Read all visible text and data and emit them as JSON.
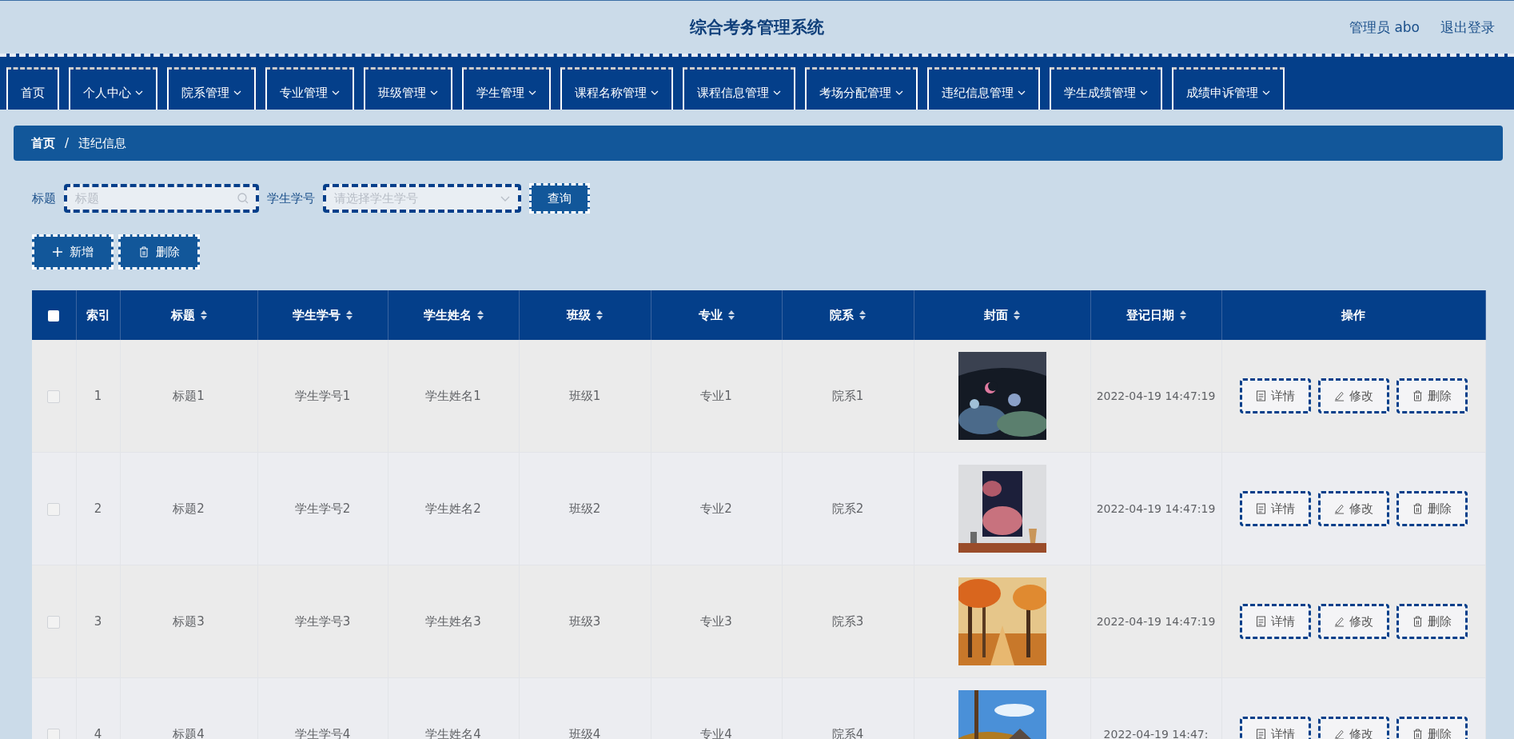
{
  "header": {
    "title": "综合考务管理系统",
    "user": "管理员 abo",
    "logout": "退出登录"
  },
  "nav": [
    {
      "label": "首页",
      "dropdown": false
    },
    {
      "label": "个人中心",
      "dropdown": true
    },
    {
      "label": "院系管理",
      "dropdown": true
    },
    {
      "label": "专业管理",
      "dropdown": true
    },
    {
      "label": "班级管理",
      "dropdown": true
    },
    {
      "label": "学生管理",
      "dropdown": true
    },
    {
      "label": "课程名称管理",
      "dropdown": true
    },
    {
      "label": "课程信息管理",
      "dropdown": true
    },
    {
      "label": "考场分配管理",
      "dropdown": true
    },
    {
      "label": "违纪信息管理",
      "dropdown": true
    },
    {
      "label": "学生成绩管理",
      "dropdown": true
    },
    {
      "label": "成绩申诉管理",
      "dropdown": true
    }
  ],
  "breadcrumb": [
    "首页",
    "/",
    "违纪信息"
  ],
  "search": {
    "title_label": "标题",
    "title_placeholder": "标题",
    "student_label": "学生学号",
    "student_placeholder": "请选择学生学号",
    "query_button": "查询"
  },
  "actions": {
    "add": "新增",
    "delete": "删除"
  },
  "table": {
    "columns": [
      {
        "label": "索引",
        "sortable": false
      },
      {
        "label": "标题",
        "sortable": true
      },
      {
        "label": "学生学号",
        "sortable": true
      },
      {
        "label": "学生姓名",
        "sortable": true
      },
      {
        "label": "班级",
        "sortable": true
      },
      {
        "label": "专业",
        "sortable": true
      },
      {
        "label": "院系",
        "sortable": true
      },
      {
        "label": "封面",
        "sortable": true
      },
      {
        "label": "登记日期",
        "sortable": true
      },
      {
        "label": "操作",
        "sortable": false
      }
    ],
    "rows": [
      {
        "checked": false,
        "index": "1",
        "title": "标题1",
        "student_no": "学生学号1",
        "student_name": "学生姓名1",
        "class": "班级1",
        "major": "专业1",
        "department": "院系1",
        "date": "2022-04-19 14:47:19"
      },
      {
        "checked": false,
        "index": "2",
        "title": "标题2",
        "student_no": "学生学号2",
        "student_name": "学生姓名2",
        "class": "班级2",
        "major": "专业2",
        "department": "院系2",
        "date": "2022-04-19 14:47:19"
      },
      {
        "checked": false,
        "index": "3",
        "title": "标题3",
        "student_no": "学生学号3",
        "student_name": "学生姓名3",
        "class": "班级3",
        "major": "专业3",
        "department": "院系3",
        "date": "2022-04-19 14:47:19"
      },
      {
        "checked": false,
        "index": "4",
        "title": "标题4",
        "student_no": "学生学号4",
        "student_name": "学生姓名4",
        "class": "班级4",
        "major": "专业4",
        "department": "院系4",
        "date": "2022-04-19 14:47:"
      }
    ],
    "row_actions": [
      [
        "详情",
        "修改",
        "删除"
      ],
      [
        "详情",
        "修改",
        "删除"
      ],
      [
        "详情",
        "修改",
        "删除"
      ],
      [
        "详情",
        "修改",
        "删除"
      ]
    ],
    "header_checked": false
  }
}
